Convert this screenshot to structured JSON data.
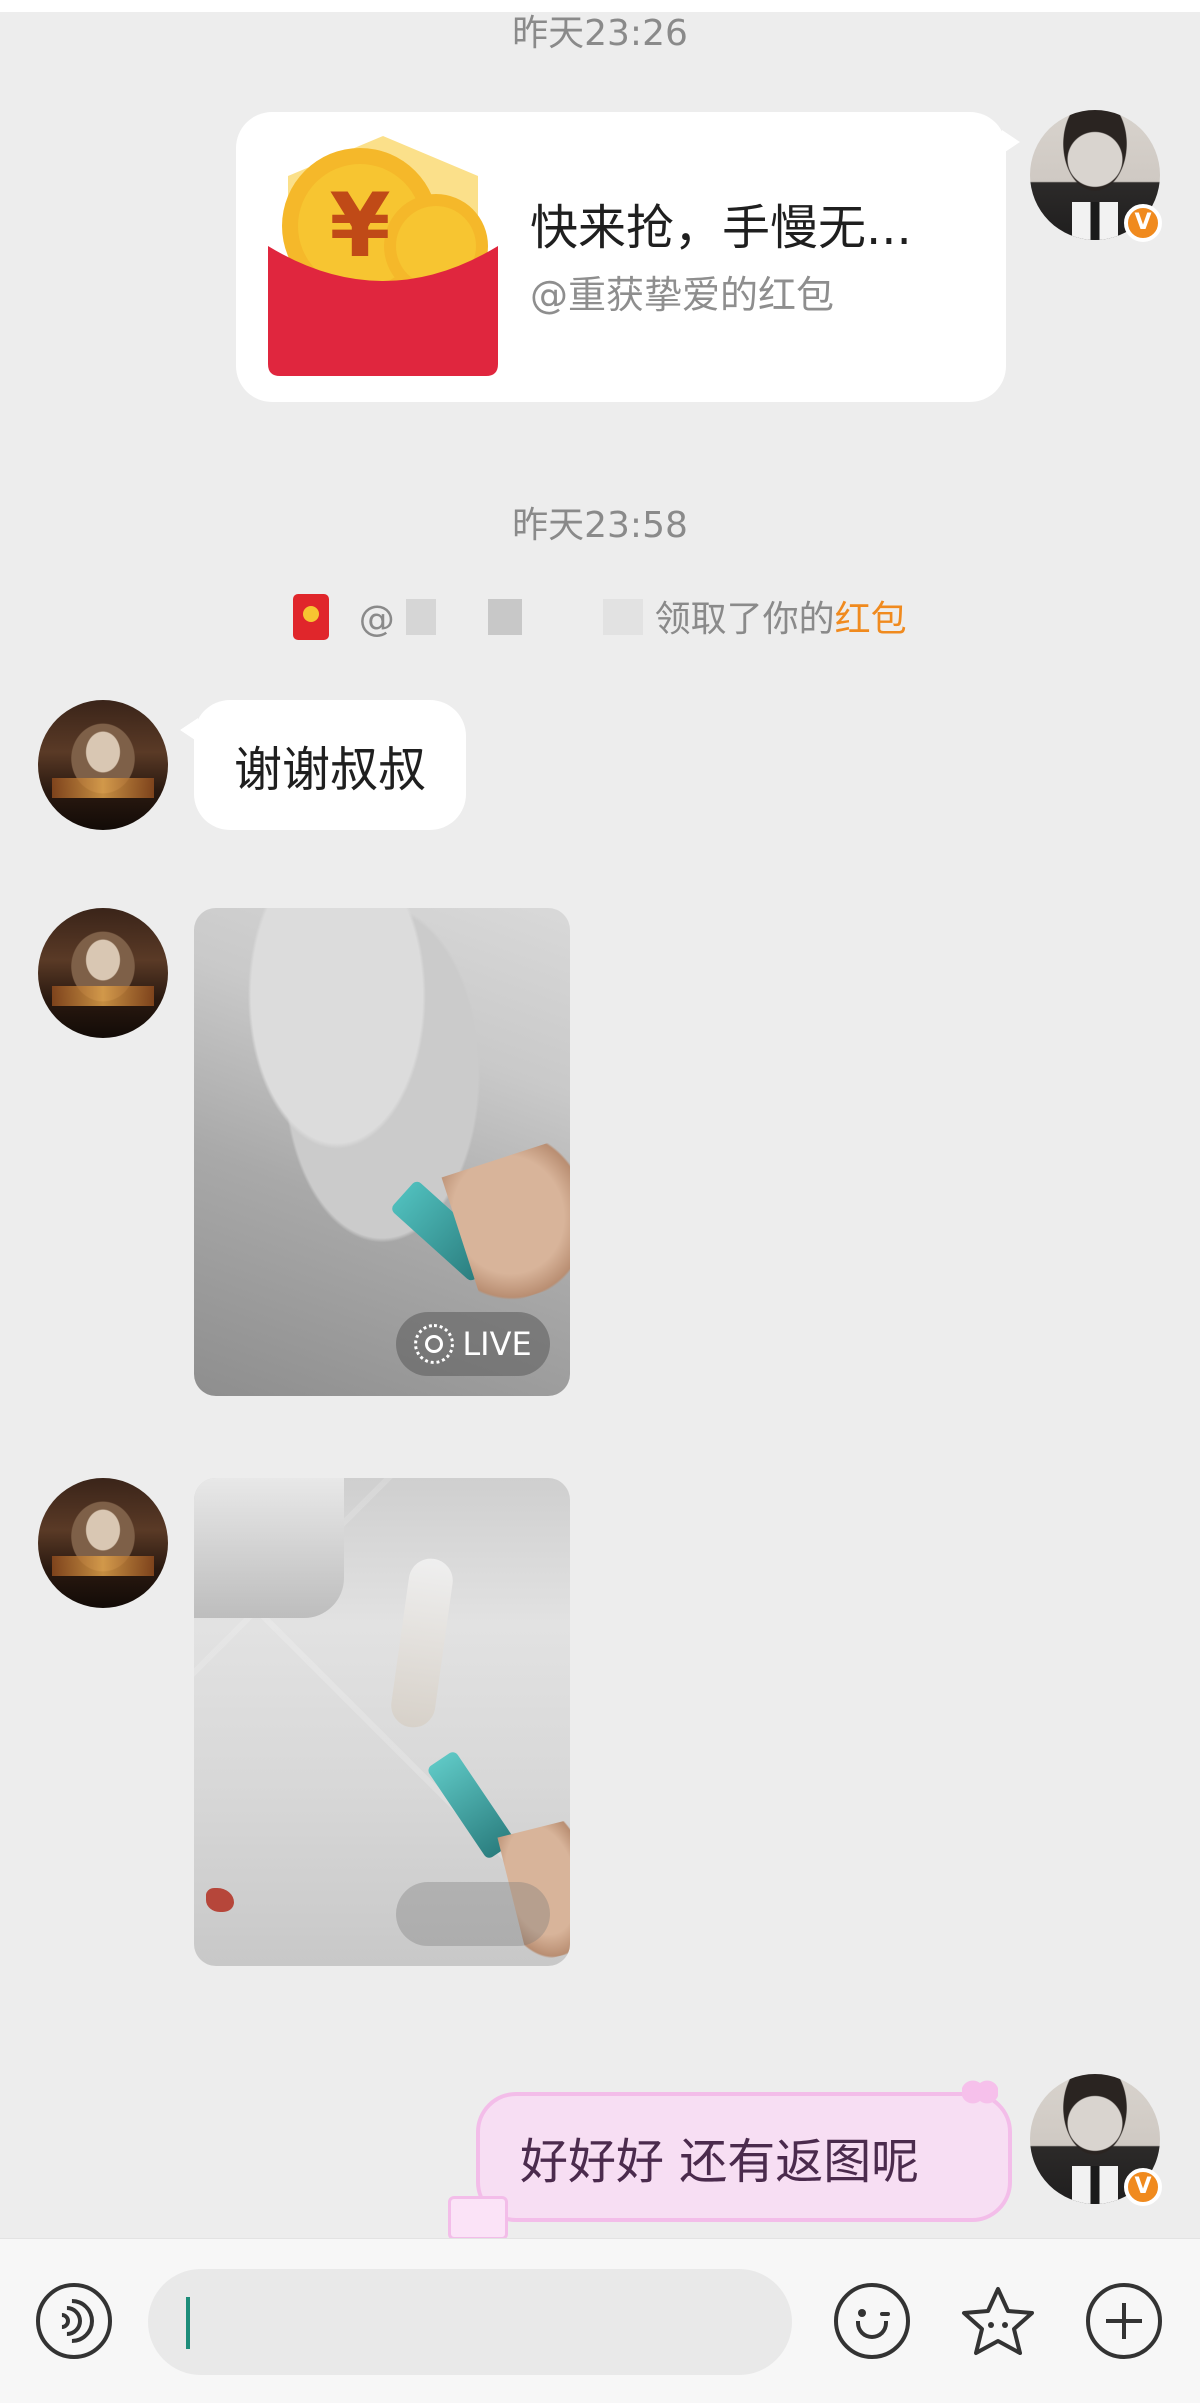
{
  "timestamps": {
    "first": "昨天23:26",
    "second": "昨天23:58"
  },
  "red_packet_card": {
    "title": "快来抢，手慢无...",
    "subtitle": "@重获挚爱的红包",
    "colors": {
      "packet": "#e0262b",
      "coin": "#f7c531"
    }
  },
  "notice": {
    "prefix": "@",
    "middle": "领取了你的",
    "highlight": "红包",
    "highlight_color": "#f08a1e"
  },
  "messages": {
    "thanks_text": "谢谢叔叔",
    "reply_text": "好好好 还有返图呢"
  },
  "photo_live_badge": "LIVE",
  "verified_badge": "V",
  "input_bar": {
    "placeholder": "",
    "icons": [
      "voice-icon",
      "emoji-icon",
      "sticker-icon",
      "plus-icon"
    ]
  },
  "colors": {
    "background": "#ededed",
    "bubble": "#ffffff",
    "fancy_bubble": "#f7def3",
    "verified": "#f08a1e",
    "caret": "#1e8d7a"
  }
}
